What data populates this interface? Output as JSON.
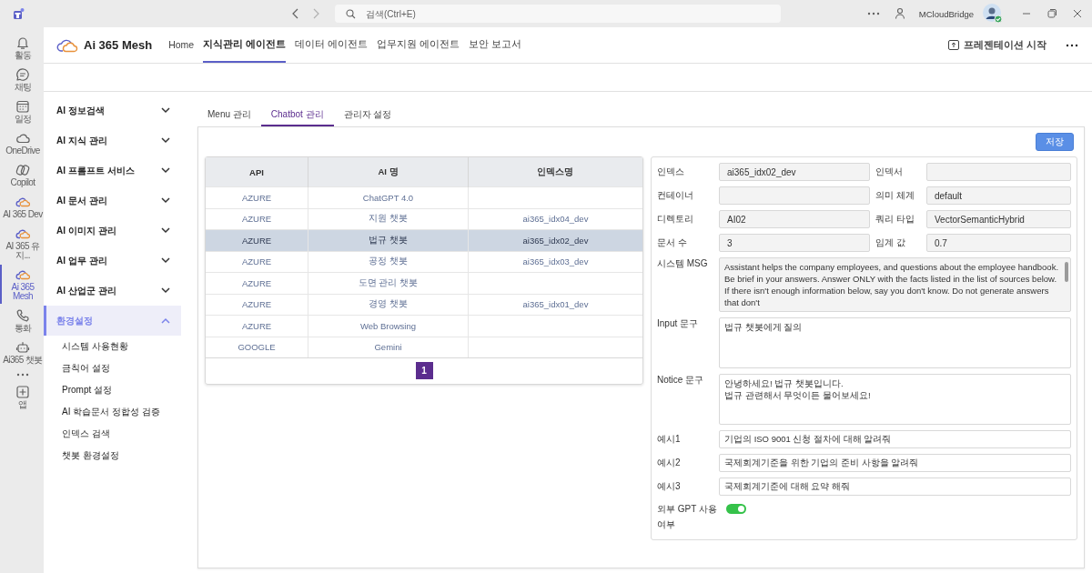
{
  "title_bar": {
    "search": {
      "placeholder": "검색(Ctrl+E)"
    },
    "account": "MCloudBridge"
  },
  "rail": [
    {
      "label": "활동",
      "selected": false
    },
    {
      "label": "채팅",
      "selected": false
    },
    {
      "label": "일정",
      "selected": false
    },
    {
      "label": "OneDrive",
      "selected": false
    },
    {
      "label": "Copilot",
      "selected": false
    },
    {
      "label": "AI 365 Dev",
      "selected": false
    },
    {
      "label": "AI 365 유지...",
      "selected": false
    },
    {
      "label": "Ai 365 Mesh",
      "selected": true
    },
    {
      "label": "통화",
      "selected": false
    },
    {
      "label": "Ai365 챗봇",
      "selected": false
    },
    {
      "selected": false
    },
    {
      "label": "앱",
      "selected": false
    }
  ],
  "header": {
    "app_name": "Ai 365 Mesh",
    "nav": [
      {
        "label": "Home",
        "selected": false
      },
      {
        "label": "지식관리 에이전트",
        "selected": true
      },
      {
        "label": "데이터 에이전트",
        "selected": false
      },
      {
        "label": "업무지원 에이전트",
        "selected": false
      },
      {
        "label": "보안 보고서",
        "selected": false
      }
    ],
    "present_button": "프레젠테이션 시작"
  },
  "sidebar": [
    {
      "label": "AI 정보검색",
      "expanded": false,
      "selected": false
    },
    {
      "label": "AI 지식 관리",
      "expanded": false,
      "selected": false
    },
    {
      "label": "AI 프롬프트 서비스",
      "expanded": false,
      "selected": false
    },
    {
      "label": "AI 문서 관리",
      "expanded": false,
      "selected": false
    },
    {
      "label": "AI 이미지 관리",
      "expanded": false,
      "selected": false
    },
    {
      "label": "AI 업무 관리",
      "expanded": false,
      "selected": false
    },
    {
      "label": "AI 산업군 관리",
      "expanded": false,
      "selected": false
    },
    {
      "label": "환경설정",
      "expanded": true,
      "selected": true,
      "children": [
        {
          "label": "시스템 사용현황"
        },
        {
          "label": "금칙어 설정"
        },
        {
          "label": "Prompt 설정"
        },
        {
          "label": "AI 학습문서 정합성 검증"
        },
        {
          "label": "인덱스 검색"
        },
        {
          "label": "챗봇 환경설정"
        }
      ]
    }
  ],
  "tabs": [
    {
      "label": "Menu 관리",
      "selected": false
    },
    {
      "label": "Chatbot 관리",
      "selected": true
    },
    {
      "label": "관리자 설정",
      "selected": false
    }
  ],
  "table": {
    "columns": [
      "API",
      "AI 명",
      "인덱스명"
    ],
    "rows": [
      {
        "cells": [
          "AZURE",
          "ChatGPT 4.0",
          null
        ],
        "selected": false
      },
      {
        "cells": [
          "AZURE",
          "지원 챗봇",
          "ai365_idx04_dev"
        ],
        "selected": false
      },
      {
        "cells": [
          "AZURE",
          "법규 챗봇",
          "ai365_idx02_dev"
        ],
        "selected": true
      },
      {
        "cells": [
          "AZURE",
          "공정 챗봇",
          "ai365_idx03_dev"
        ],
        "selected": false
      },
      {
        "cells": [
          "AZURE",
          "도면 관리 챗봇",
          null
        ],
        "selected": false
      },
      {
        "cells": [
          "AZURE",
          "경영 챗봇",
          "ai365_idx01_dev"
        ],
        "selected": false
      },
      {
        "cells": [
          "AZURE",
          "Web Browsing",
          null
        ],
        "selected": false
      },
      {
        "cells": [
          "GOOGLE",
          "Gemini",
          null
        ],
        "selected": false
      }
    ],
    "pages": [
      {
        "label": "1",
        "selected": true
      }
    ]
  },
  "form": {
    "save_button": "저장",
    "fields": [
      {
        "label": "인덱스",
        "value": "ai365_idx02_dev"
      },
      {
        "label": "인덱서"
      },
      {
        "label": "컨테이너"
      },
      {
        "label": "의미 체계",
        "value": "default"
      },
      {
        "label": "디렉토리",
        "value": "AI02"
      },
      {
        "label": "쿼리 타입",
        "value": "VectorSemanticHybrid"
      },
      {
        "label": "문서 수",
        "value": "3"
      },
      {
        "label": "임계 값",
        "value": "0.7"
      }
    ],
    "text_areas": [
      {
        "label": "시스템 MSG",
        "value": "Assistant helps the company employees, and questions about the employee handbook. Be brief in your answers. Answer ONLY with the facts listed in the list of sources below.  If there isn't enough information below, say you don't know. Do not generate answers that don't"
      },
      {
        "label": "Input 문구",
        "value": "법규 챗봇에게 질의"
      },
      {
        "label": "Notice 문구",
        "value": "안녕하세요! 법규 챗봇입니다.\n법규 관련해서 무엇이든 물어보세요!"
      }
    ],
    "examples": [
      {
        "label": "예시1",
        "value": "기업의 ISO 9001 신청 절차에 대해 알려줘"
      },
      {
        "label": "예시2",
        "value": "국제회계기준을 위한 기업의 준비 사항을 알려줘"
      },
      {
        "label": "예시3",
        "value": "국제회계기준에 대해 요약 해줘"
      }
    ],
    "toggle": {
      "label": "외부 GPT 사용 여부",
      "on": true
    }
  }
}
